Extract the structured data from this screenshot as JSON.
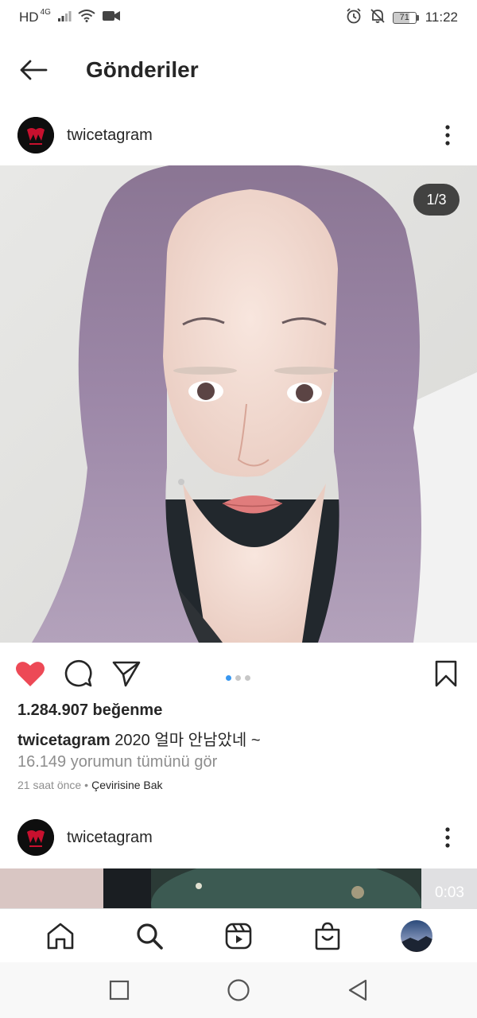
{
  "status_bar": {
    "network": "HD",
    "signal_type": "4G",
    "battery": "71",
    "time": "11:22",
    "icons": [
      "signal-icon",
      "wifi-icon",
      "video-icon",
      "alarm-icon",
      "mute-icon",
      "battery-icon"
    ]
  },
  "header": {
    "title": "Gönderiler",
    "back_icon": "back-arrow-icon"
  },
  "posts": [
    {
      "username": "twicetagram",
      "image_counter": "1/3",
      "likes": "1.284.907 beğenme",
      "caption_user": "twicetagram",
      "caption_text": "2020 얼마 안남았네 ~",
      "comments_link": "16.149 yorumun tümünü gör",
      "time_ago": "21 saat önce",
      "separator": "•",
      "translate": "Çevirisine Bak",
      "liked": true,
      "carousel_count": 3,
      "carousel_active": 0
    },
    {
      "username": "twicetagram",
      "video_time": "0:03"
    }
  ],
  "actions": {
    "like_icon": "heart-icon",
    "comment_icon": "comment-icon",
    "share_icon": "send-icon",
    "save_icon": "bookmark-icon",
    "like_color": "#ed4956"
  },
  "bottom_nav": [
    "home-icon",
    "search-icon",
    "reels-icon",
    "shop-icon",
    "profile-avatar"
  ],
  "system_nav": [
    "recents-icon",
    "home-circle-icon",
    "back-triangle-icon"
  ]
}
